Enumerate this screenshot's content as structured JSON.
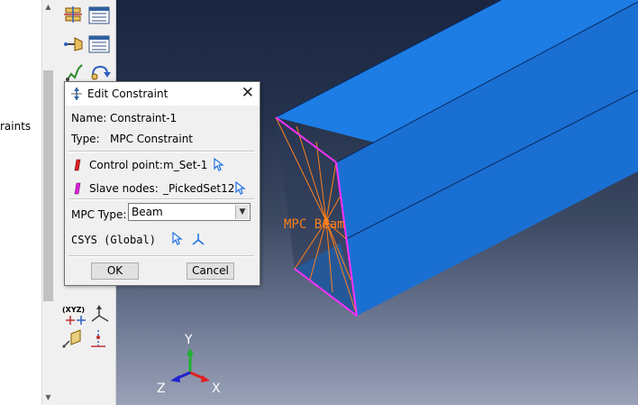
{
  "left_panel": {
    "tree_text": "raints"
  },
  "dialog": {
    "title": "Edit Constraint",
    "name_label": "Name:",
    "name_value": "Constraint-1",
    "type_label": "Type:",
    "type_value": "MPC Constraint",
    "control_point_label": "Control point:",
    "control_point_value": "m_Set-1",
    "slave_nodes_label": "Slave nodes:",
    "slave_nodes_value": "_PickedSet12",
    "mpc_type_label": "MPC Type:",
    "mpc_type_value": "Beam",
    "csys_label": "CSYS (Global)",
    "ok_label": "OK",
    "cancel_label": "Cancel",
    "colors": {
      "control_point_flag": "#e02020",
      "slave_nodes_flag": "#e020e0",
      "pick_arrow": "#1e6fe0"
    }
  },
  "viewport": {
    "annotation": "MPC Beam",
    "triad": {
      "y_label": "Y",
      "z_label": "Z",
      "x_label": "X"
    },
    "colors": {
      "beam_face": "#1f7ee6",
      "beam_dark": "#0a3a78",
      "mpc_lines": "#ff7f1a",
      "highlight_edge": "#ff30ff",
      "triad_x": "#e02020",
      "triad_y": "#20b030",
      "triad_z": "#2020d0"
    }
  },
  "toolbox": {
    "xyz_label": "(XYZ)"
  }
}
